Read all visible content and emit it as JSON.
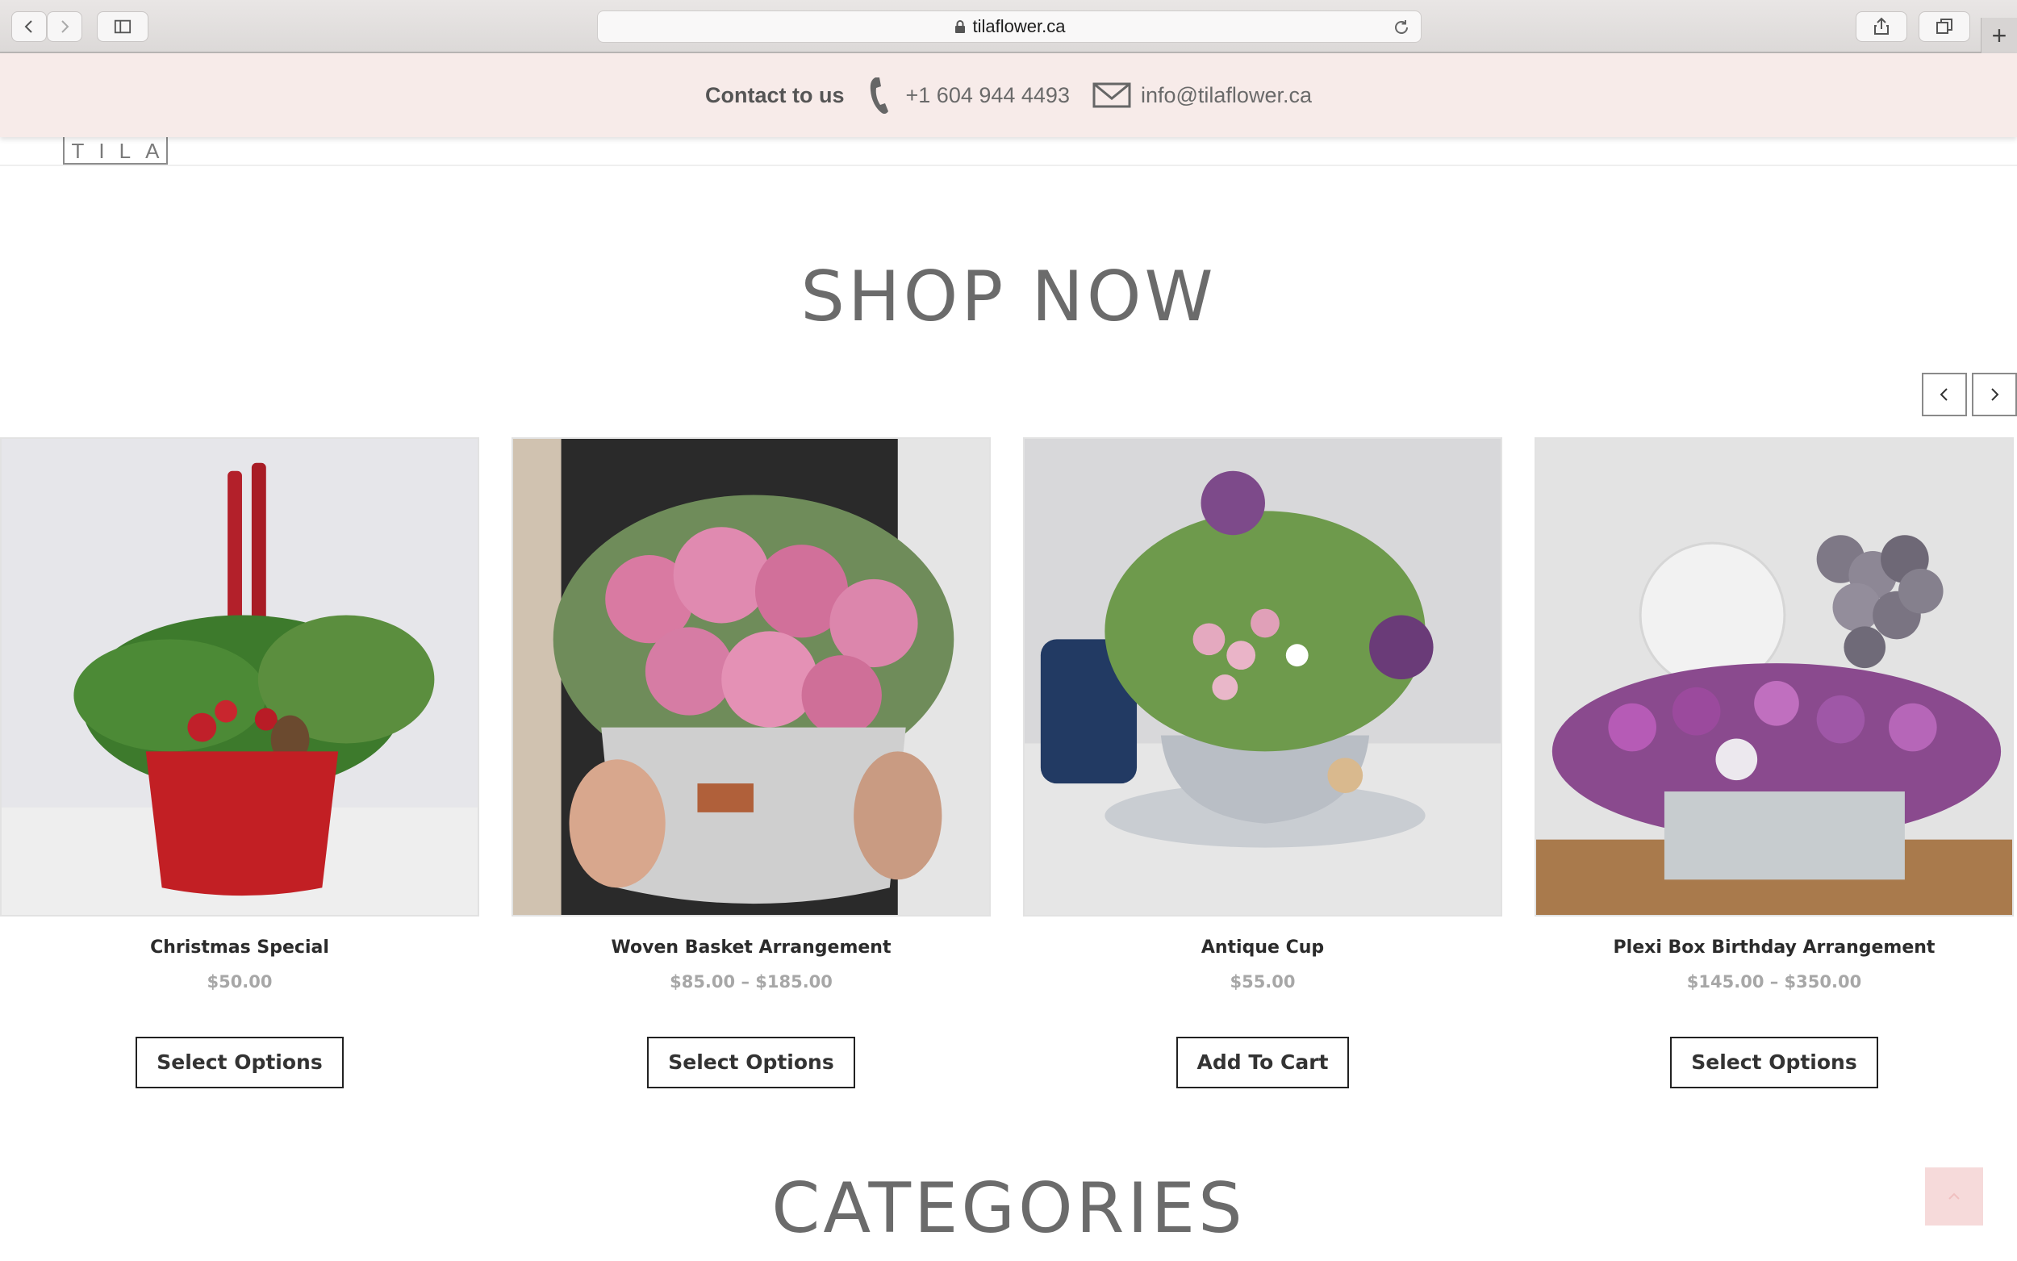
{
  "browser": {
    "url": "tilaflower.ca",
    "new_tab_label": "+"
  },
  "contact": {
    "label": "Contact to us",
    "phone": "+1 604 944 4493",
    "email": "info@tilaflower.ca"
  },
  "header": {
    "logo_text": "TILA"
  },
  "shop": {
    "title": "SHOP NOW"
  },
  "products": [
    {
      "name": "Christmas Special",
      "price": "$50.00",
      "button": "Select Options"
    },
    {
      "name": "Woven Basket Arrangement",
      "price": "$85.00 – $185.00",
      "button": "Select Options"
    },
    {
      "name": "Antique Cup",
      "price": "$55.00",
      "button": "Add To Cart"
    },
    {
      "name": "Plexi Box Birthday Arrangement",
      "price": "$145.00 – $350.00",
      "button": "Select Options"
    }
  ],
  "categories": {
    "title": "CATEGORIES"
  },
  "colors": {
    "contact_bar_bg": "#f7ebe9",
    "heading_text": "#6b6b6b",
    "price_text": "#a7a7a7",
    "back_to_top_bg": "#f6dada"
  }
}
